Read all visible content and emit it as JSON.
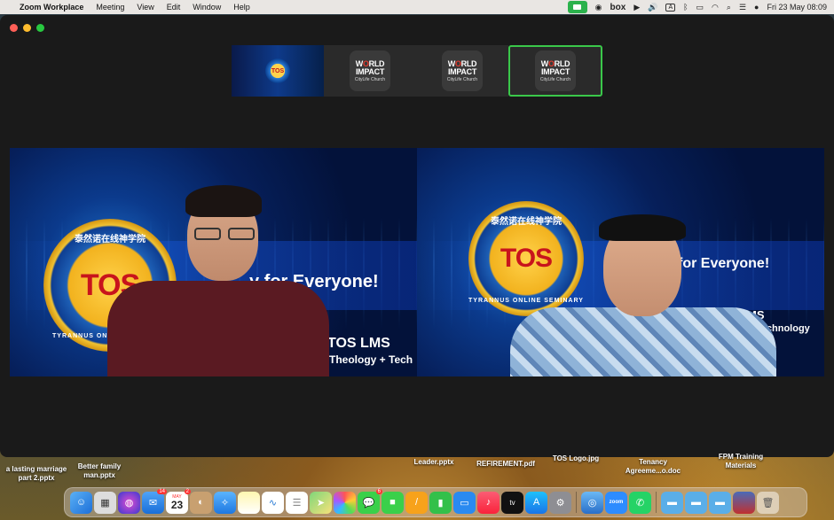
{
  "menubar": {
    "app_name": "Zoom Workplace",
    "menus": [
      "Meeting",
      "View",
      "Edit",
      "Window",
      "Help"
    ],
    "box_label": "box",
    "a_label": "A",
    "datetime": "Fri 23 May  08:09"
  },
  "thumbnails": [
    {
      "type": "tos-logo",
      "label": "TOS"
    },
    {
      "type": "world-impact",
      "line1_pre": "W",
      "line1_o": "O",
      "line1_post": "RLD",
      "line2": "IMPACT",
      "line3": "CityLife Church"
    },
    {
      "type": "world-impact",
      "line1_pre": "W",
      "line1_o": "O",
      "line1_post": "RLD",
      "line2": "IMPACT",
      "line3": "CityLife Church"
    },
    {
      "type": "world-impact",
      "line1_pre": "W",
      "line1_o": "O",
      "line1_post": "RLD",
      "line2": "IMPACT",
      "line3": "CityLife Church",
      "active": true
    }
  ],
  "tiles": {
    "left": {
      "badge_cn": "泰然诺在线神学院",
      "badge_tos": "TOS",
      "badge_ring": "TYRANNUS ONLINE SEMINARY",
      "slogan": "y for Everyone!",
      "lms": "TOS LMS",
      "tagline": "Theology + Tech"
    },
    "right": {
      "badge_cn": "泰然诺在线神学院",
      "badge_tos": "TOS",
      "badge_ring": "TYRANNUS ONLINE SEMINARY",
      "slogan": "for Everyone!",
      "lms": "TOS LMS",
      "tagline": "ology + Technology"
    }
  },
  "desktop_files": [
    {
      "label": "a lasting marriage\npart 2.pptx"
    },
    {
      "label": "Better family\nman.pptx"
    },
    {
      "label": "Leader.pptx"
    },
    {
      "label": "REFIREMENT.pdf"
    },
    {
      "label": "TOS Logo.jpg"
    },
    {
      "label": "Tenancy\nAgreeme...o.doc"
    },
    {
      "label": "FPM Training\nMaterials"
    }
  ],
  "dock": {
    "calendar_month": "MAY",
    "calendar_day": "23",
    "mail_badge": "14",
    "calendar_badge": "2",
    "messages_badge": "6",
    "zoom_label": "zoom",
    "tv_label": "tv",
    "icons": [
      "finder-icon",
      "launchpad-icon",
      "siri-icon",
      "mail-icon",
      "calendar-icon",
      "contacts-icon",
      "safari-icon",
      "notes-icon",
      "freeform-icon",
      "reminders-icon",
      "maps-icon",
      "photos-icon",
      "messages-icon",
      "facetime-icon",
      "pages-icon",
      "numbers-icon",
      "keynote-icon",
      "music-icon",
      "tv-icon",
      "app-store-icon",
      "settings-icon",
      "network-icon",
      "zoom-icon",
      "whatsapp-icon",
      "folder-icon",
      "folder-icon",
      "folder-icon",
      "screenshot-icon",
      "trash-icon"
    ]
  },
  "colors": {
    "active_border": "#3ac84a",
    "menubar_bg": "#e9e6e3",
    "zoom_green": "#2bb24c"
  }
}
